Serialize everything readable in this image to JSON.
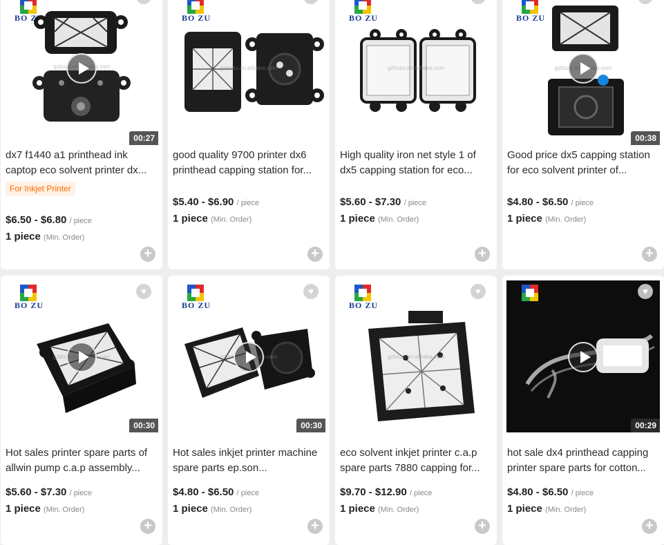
{
  "logo_text": "BO ZU",
  "watermark": "gzbozu.en.alibaba.com",
  "unit_label": "/ piece",
  "min_order_label": "(Min. Order)",
  "accent_color": "#ff6a00",
  "products": [
    {
      "title": "dx7 f1440 a1 printhead ink captop eco solvent printer dx...",
      "tag": "For Inkjet Printer",
      "price": "$6.50 - $6.80",
      "moq": "1 piece",
      "duration": "00:27",
      "has_video": true
    },
    {
      "title": "good quality 9700 printer dx6 printhead capping station for...",
      "price": "$5.40 - $6.90",
      "moq": "1 piece",
      "has_video": false
    },
    {
      "title": "High quality iron net style 1 of dx5 capping station for eco...",
      "price": "$5.60 - $7.30",
      "moq": "1 piece",
      "has_video": false
    },
    {
      "title": "Good price dx5 capping station for eco solvent printer of...",
      "price": "$4.80 - $6.50",
      "moq": "1 piece",
      "duration": "00:38",
      "has_video": true
    },
    {
      "title": "Hot sales printer spare parts of allwin pump c.a.p assembly...",
      "price": "$5.60 - $7.30",
      "moq": "1 piece",
      "duration": "00:30",
      "has_video": true
    },
    {
      "title": "Hot sales inkjet printer machine spare parts ep.son...",
      "price": "$4.80 - $6.50",
      "moq": "1 piece",
      "duration": "00:30",
      "has_video": true
    },
    {
      "title": "eco solvent inkjet printer c.a.p spare parts 7880 capping for...",
      "price": "$9.70 - $12.90",
      "moq": "1 piece",
      "has_video": false
    },
    {
      "title": "hot sale dx4 printhead capping printer spare parts for cotton...",
      "price": "$4.80 - $6.50",
      "moq": "1 piece",
      "duration": "00:29",
      "has_video": true
    }
  ]
}
